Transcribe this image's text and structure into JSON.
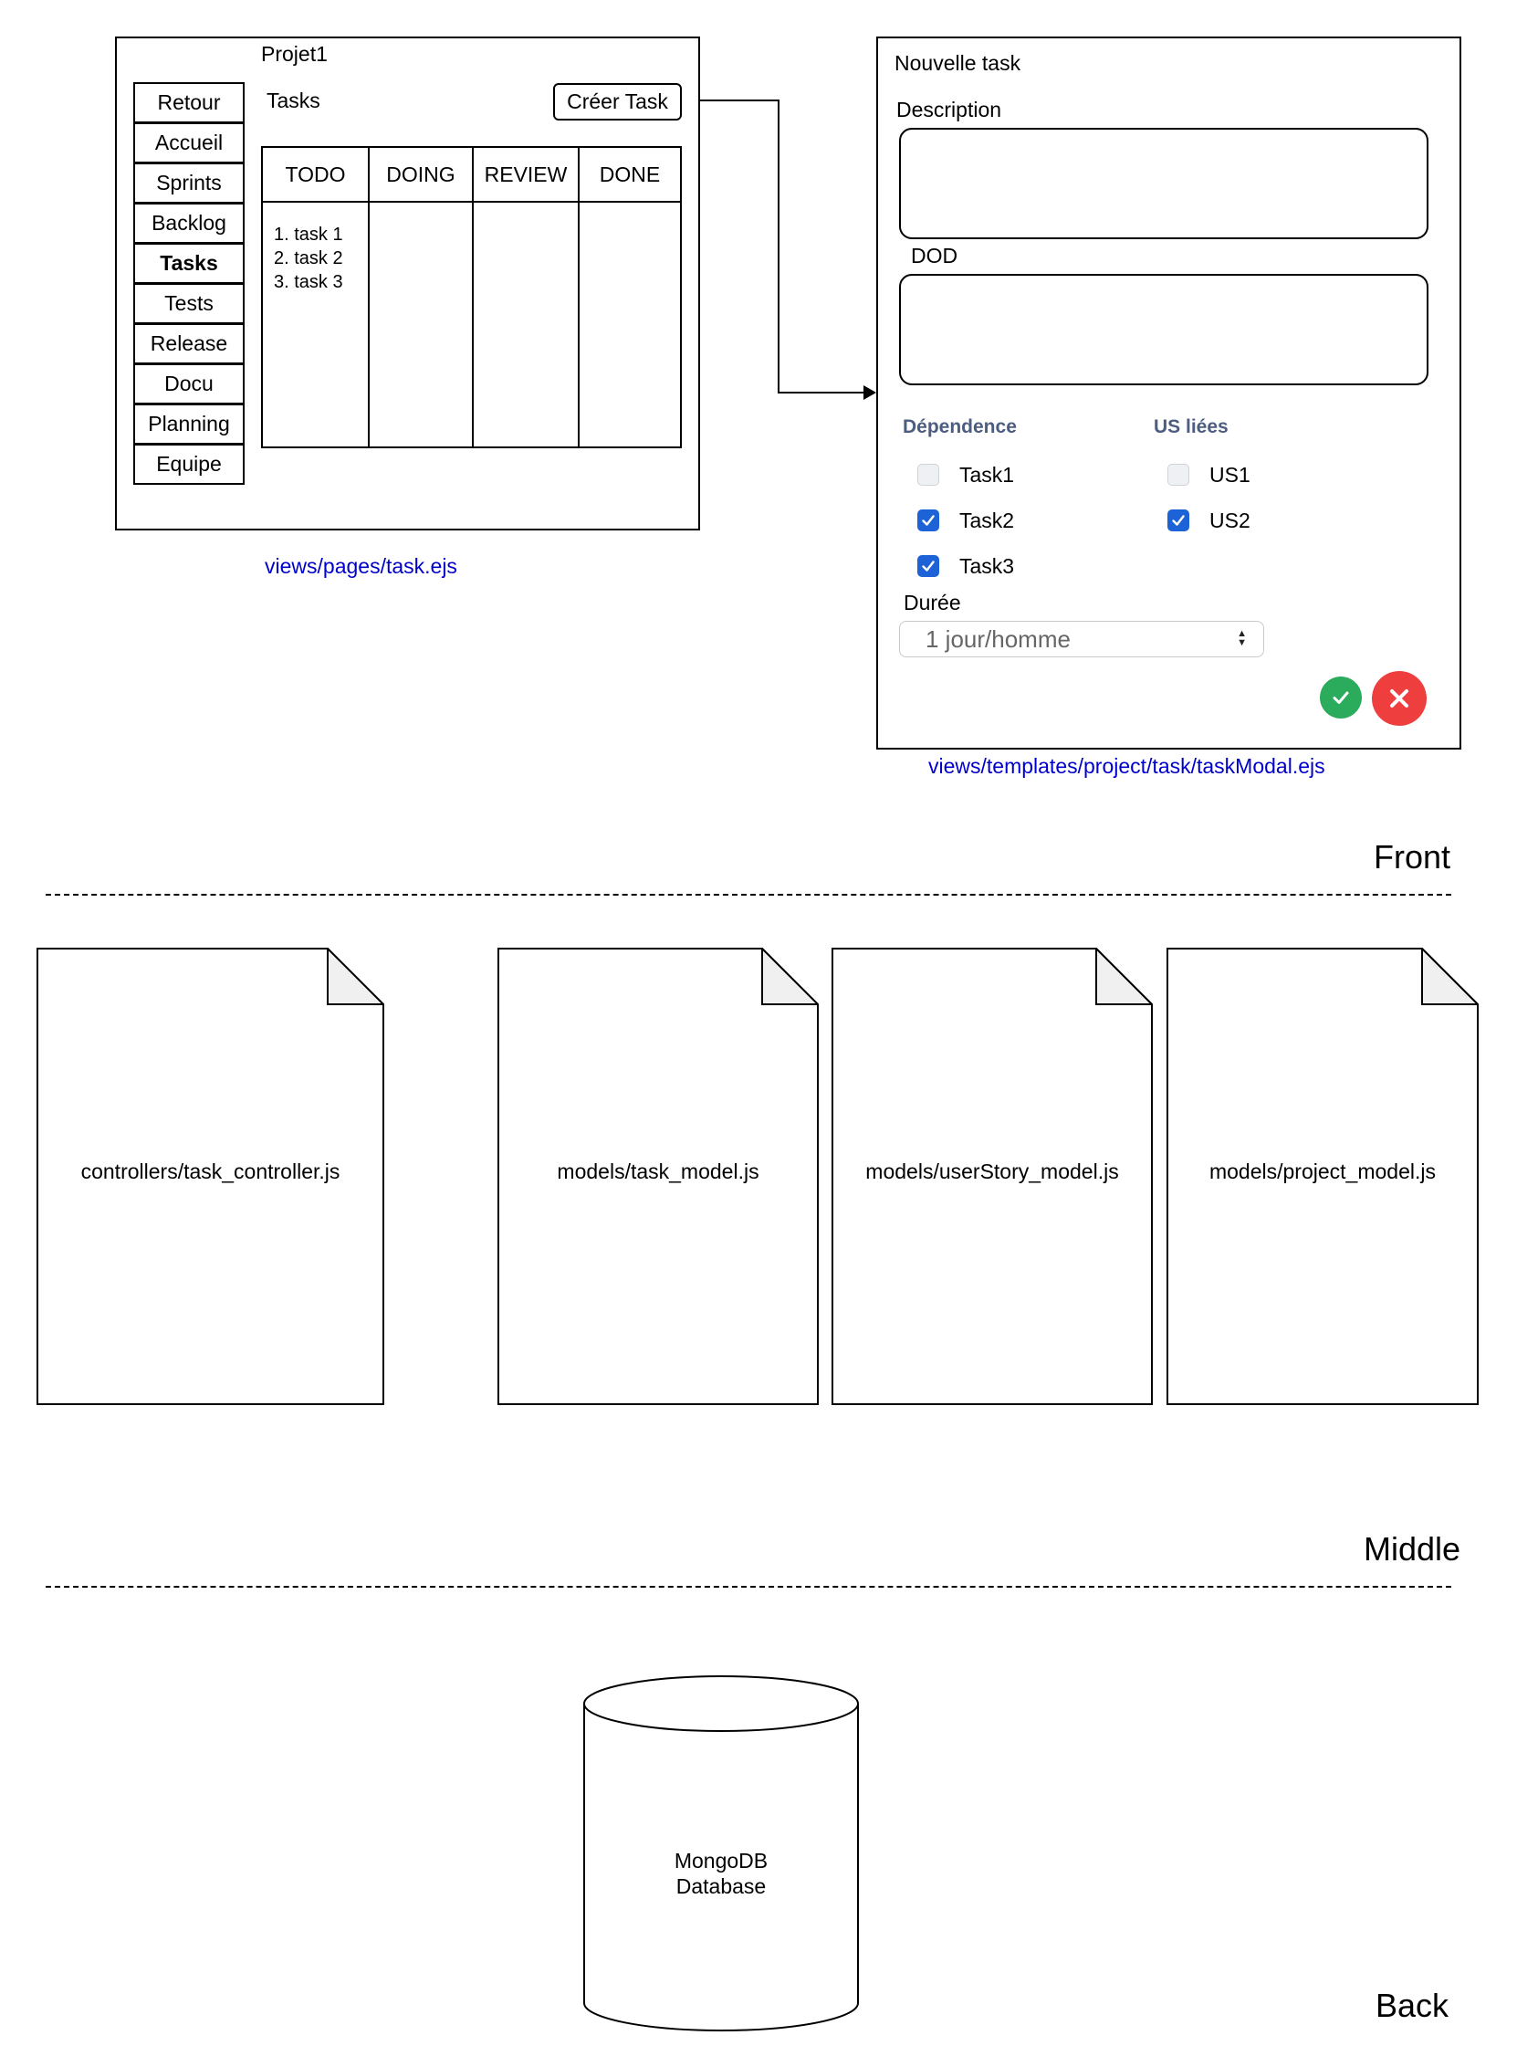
{
  "task_page": {
    "project_title": "Projet1",
    "nav": [
      "Retour",
      "Accueil",
      "Sprints",
      "Backlog",
      "Tasks",
      "Tests",
      "Release",
      "Docu",
      "Planning",
      "Equipe"
    ],
    "active_nav": "Tasks",
    "section_title": "Tasks",
    "create_button": "Créer Task",
    "columns": [
      "TODO",
      "DOING",
      "REVIEW",
      "DONE"
    ],
    "todo_items": [
      "1. task 1",
      "2. task 2",
      "3. task 3"
    ],
    "file": "views/pages/task.ejs"
  },
  "task_modal": {
    "title": "Nouvelle task",
    "description_label": "Description",
    "dod_label": "DOD",
    "dependence_label": "Dépendence",
    "dependencies": [
      {
        "label": "Task1",
        "checked": false
      },
      {
        "label": "Task2",
        "checked": true
      },
      {
        "label": "Task3",
        "checked": true
      }
    ],
    "us_label": "US liées",
    "user_stories": [
      {
        "label": "US1",
        "checked": false
      },
      {
        "label": "US2",
        "checked": true
      }
    ],
    "duration_label": "Durée",
    "duration_value": "1 jour/homme",
    "confirm_icon": "check-icon",
    "cancel_icon": "close-icon",
    "confirm_color": "#2bab5c",
    "cancel_color": "#ee3e3e",
    "file": "views/templates/project/task/taskModal.ejs"
  },
  "layers": {
    "front": "Front",
    "middle": "Middle",
    "back": "Back"
  },
  "middle_files": [
    "controllers/task_controller.js",
    "models/task_model.js",
    "models/userStory_model.js",
    "models/project_model.js"
  ],
  "database": {
    "line1": "MongoDB",
    "line2": "Database"
  },
  "colors": {
    "link": "#0000cc",
    "checkbox_checked": "#1d62d6",
    "group_heading": "#4d5d80"
  }
}
